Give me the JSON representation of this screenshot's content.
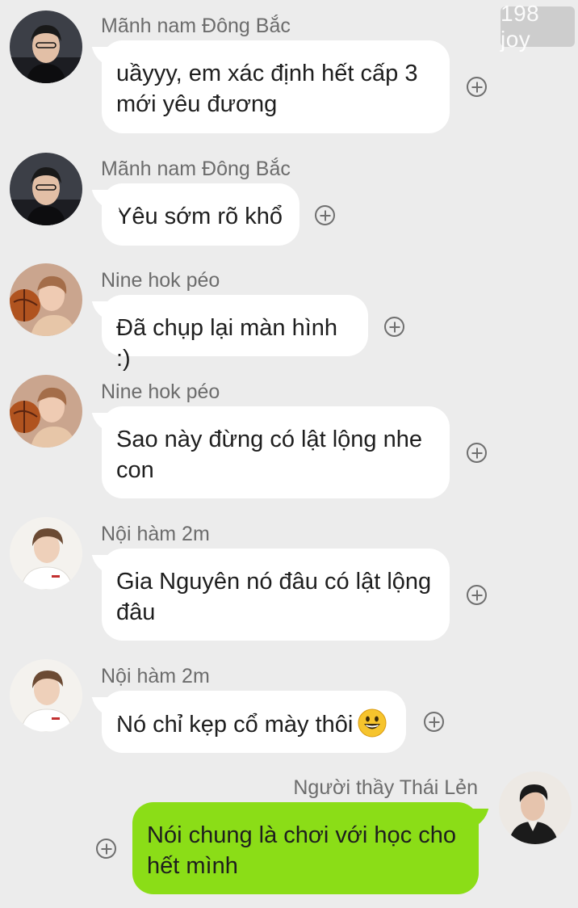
{
  "watermark": "198 joy",
  "messages": [
    {
      "sender": "Mãnh nam Đông Bắc",
      "text": "uầyyy, em xác định hết cấp 3 mới yêu đương",
      "avatar": "avatar-icon",
      "side": "incoming"
    },
    {
      "sender": "Mãnh nam Đông Bắc",
      "text": "Yêu sớm rõ khổ",
      "avatar": "avatar-icon",
      "side": "incoming"
    },
    {
      "sender": "Nine hok péo",
      "text": "Đã chụp lại màn hình :)",
      "avatar": "avatar-icon",
      "side": "incoming"
    },
    {
      "sender": "Nine hok péo",
      "text": "Sao này đừng có lật lộng nhe con",
      "avatar": "avatar-icon",
      "side": "incoming"
    },
    {
      "sender": "Nội hàm 2m",
      "text": "Gia Nguyên nó đâu có lật lộng đâu",
      "avatar": "avatar-icon",
      "side": "incoming"
    },
    {
      "sender": "Nội hàm 2m",
      "text": "Nó chỉ kẹp cổ mày thôi",
      "emoji": "grinning-face-emoji",
      "avatar": "avatar-icon",
      "side": "incoming"
    },
    {
      "sender": "Người thầy Thái Lẻn",
      "text": "Nói chung là chơi với học cho hết mình",
      "avatar": "avatar-icon",
      "side": "outgoing"
    }
  ],
  "icons": {
    "plus": "plus-circle-icon"
  },
  "colors": {
    "background": "#ececec",
    "incoming_bubble": "#ffffff",
    "outgoing_bubble": "#8bdd17",
    "sender_text": "#6c6c6c"
  }
}
